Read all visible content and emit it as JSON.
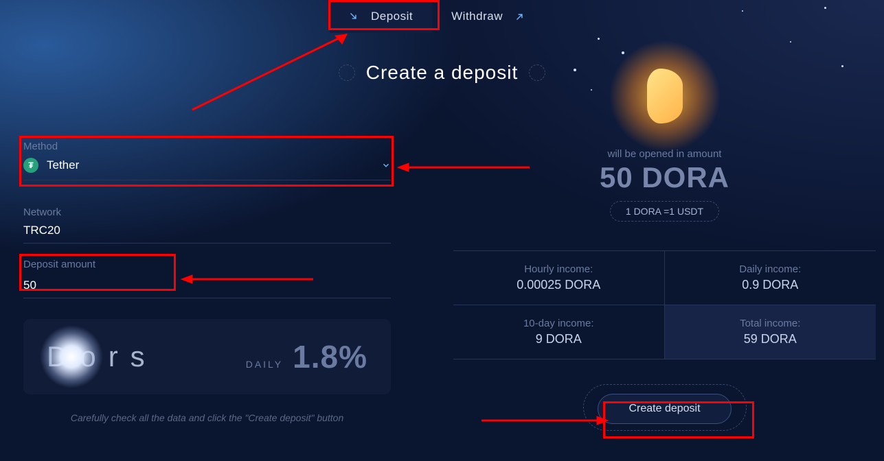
{
  "tabs": {
    "deposit": "Deposit",
    "withdraw": "Withdraw"
  },
  "page_title": "Create a deposit",
  "method": {
    "label": "Method",
    "value": "Tether"
  },
  "network": {
    "label": "Network",
    "value": "TRC20"
  },
  "amount": {
    "label": "Deposit amount",
    "value": "50"
  },
  "plan": {
    "name": "Dors",
    "daily_label": "DAILY",
    "daily_value": "1.8%"
  },
  "footer_note": "Carefully check all the data and click the \"Create deposit\" button",
  "opened": {
    "label": "will be opened in amount",
    "value": "50 DORA"
  },
  "rate": "1 DORA =1 USDT",
  "stats": {
    "hourly": {
      "label": "Hourly income:",
      "value": "0.00025 DORA"
    },
    "daily": {
      "label": "Daily income:",
      "value": "0.9 DORA"
    },
    "tenday": {
      "label": "10-day income:",
      "value": "9 DORA"
    },
    "total": {
      "label": "Total income:",
      "value": "59 DORA"
    }
  },
  "create_label": "Create deposit"
}
